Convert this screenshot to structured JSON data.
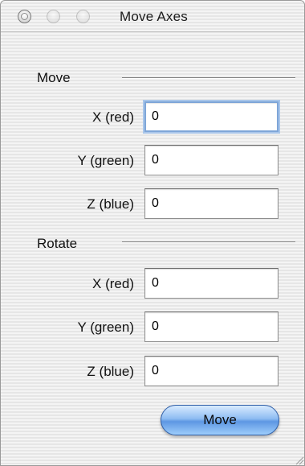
{
  "window": {
    "title": "Move Axes"
  },
  "move_section": {
    "label": "Move",
    "fields": [
      {
        "label": "X (red)",
        "value": "0"
      },
      {
        "label": "Y (green)",
        "value": "0"
      },
      {
        "label": "Z (blue)",
        "value": "0"
      }
    ]
  },
  "rotate_section": {
    "label": "Rotate",
    "fields": [
      {
        "label": "X (red)",
        "value": "0"
      },
      {
        "label": "Y (green)",
        "value": "0"
      },
      {
        "label": "Z (blue)",
        "value": "0"
      }
    ]
  },
  "actions": {
    "move_label": "Move"
  },
  "colors": {
    "focus_ring": "#7fa6d8",
    "button_aqua": "#5d97e3"
  }
}
